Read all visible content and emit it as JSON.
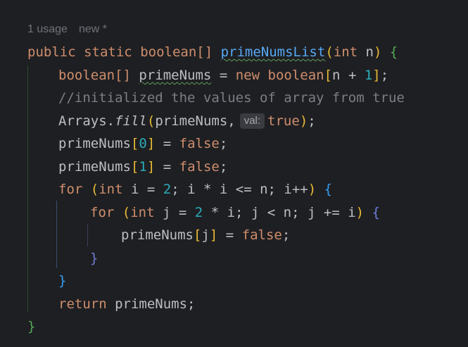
{
  "inlay": {
    "usages": "1 usage",
    "status": "new *"
  },
  "code": {
    "l1": {
      "public": "public",
      "static": "static",
      "type": "boolean[]",
      "method": "primeNumsList",
      "open_paren": "(",
      "param_type": "int",
      "param_name": "n",
      "close_paren": ")",
      "open_brace": "{"
    },
    "l2": {
      "type": "boolean[]",
      "var": "primeNums",
      "eq": "=",
      "new": "new",
      "type2": "boolean",
      "open_bracket": "[",
      "n": "n",
      "plus": "+",
      "one": "1",
      "close_bracket": "]",
      "semi": ";"
    },
    "l3": {
      "comment": "//initialized the values of array from true"
    },
    "l4": {
      "cls": "Arrays",
      "dot": ".",
      "method": "fill",
      "open_paren": "(",
      "arg1": "primeNums,",
      "hint": "val:",
      "arg2": "true",
      "close_paren": ")",
      "semi": ";"
    },
    "l5": {
      "var": "primeNums",
      "open_bracket": "[",
      "idx": "0",
      "close_bracket": "]",
      "eq": "=",
      "val": "false",
      "semi": ";"
    },
    "l6": {
      "var": "primeNums",
      "open_bracket": "[",
      "idx": "1",
      "close_bracket": "]",
      "eq": "=",
      "val": "false",
      "semi": ";"
    },
    "l7": {
      "for": "for",
      "open_paren": "(",
      "int": "int",
      "init": "i =",
      "two": "2",
      "cond_a": "; i * i <=",
      "n": "n",
      "incr": "; i++",
      "close_paren": ")",
      "open_brace": "{"
    },
    "l8": {
      "for": "for",
      "open_paren": "(",
      "int": "int",
      "init": "j =",
      "two": "2",
      "rest_a": "* i; j <",
      "n": "n",
      "rest_b": "; j += i",
      "close_paren": ")",
      "open_brace": "{"
    },
    "l9": {
      "var": "primeNums",
      "open_bracket": "[",
      "idx": "j",
      "close_bracket": "]",
      "eq": "=",
      "val": "false",
      "semi": ";"
    },
    "l10": {
      "close_brace": "}"
    },
    "l11": {
      "close_brace": "}"
    },
    "l12": {
      "return": "return",
      "var": "primeNums",
      "semi": ";"
    },
    "l13": {
      "close_brace": "}"
    }
  },
  "colors": {
    "background": "#1e1f22",
    "keyword": "#cf8e6d",
    "method": "#56a8f5",
    "field": "#c77dbb",
    "number": "#2aacb8",
    "comment": "#7a7e85",
    "bracket_level1": "#e8ba36",
    "bracket_level2": "#54a857",
    "bracket_level3": "#359ff4",
    "bracket_level4": "#6e7ed9"
  }
}
